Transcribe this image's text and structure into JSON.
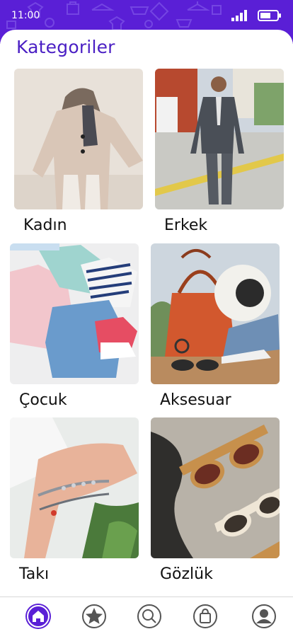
{
  "status_bar": {
    "time": "11:00"
  },
  "page": {
    "title": "Kategoriler"
  },
  "categories": [
    {
      "label": "Kadın"
    },
    {
      "label": "Erkek"
    },
    {
      "label": "Çocuk"
    },
    {
      "label": "Aksesuar"
    },
    {
      "label": "Takı"
    },
    {
      "label": "Gözlük"
    }
  ],
  "bottom_nav": {
    "active": "home",
    "items": [
      "home-icon",
      "star-icon",
      "search-icon",
      "bag-icon",
      "profile-icon"
    ]
  },
  "colors": {
    "brand": "#5a1fd6",
    "title": "#4a1fc4",
    "nav_icon": "#555555"
  }
}
